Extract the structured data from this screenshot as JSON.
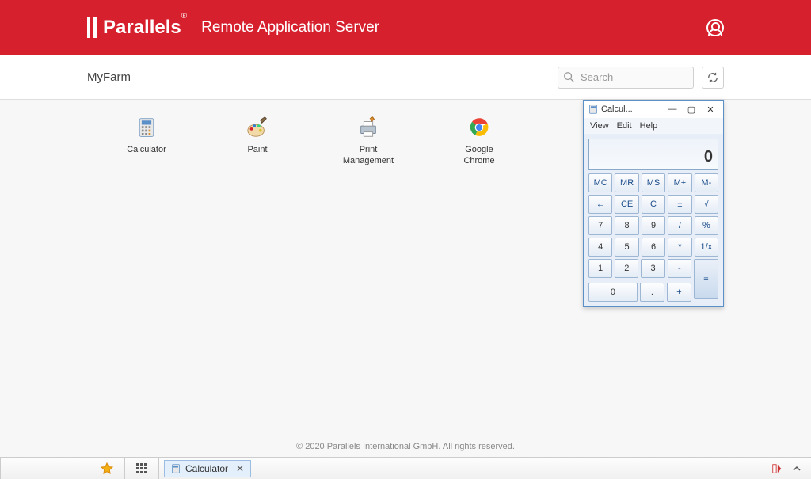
{
  "header": {
    "brand_name": "Parallels",
    "brand_reg": "®",
    "product": "Remote Application Server"
  },
  "subheader": {
    "farm": "MyFarm",
    "search_placeholder": "Search"
  },
  "apps": [
    {
      "label": "Calculator"
    },
    {
      "label": "Paint"
    },
    {
      "label": "Print Management"
    },
    {
      "label": "Google Chrome"
    }
  ],
  "calculator": {
    "title": "Calcul...",
    "menu": {
      "view": "View",
      "edit": "Edit",
      "help": "Help"
    },
    "display": "0",
    "mem": {
      "mc": "MC",
      "mr": "MR",
      "ms": "MS",
      "mplus": "M+",
      "mminus": "M-"
    },
    "ops": {
      "back": "←",
      "ce": "CE",
      "c": "C",
      "pm": "±",
      "sqrt": "√",
      "div": "/",
      "pct": "%",
      "mul": "*",
      "inv": "1/x",
      "sub": "-",
      "add": "+",
      "eq": "=",
      "dot": "."
    },
    "nums": {
      "n0": "0",
      "n1": "1",
      "n2": "2",
      "n3": "3",
      "n4": "4",
      "n5": "5",
      "n6": "6",
      "n7": "7",
      "n8": "8",
      "n9": "9"
    }
  },
  "taskbar": {
    "task_label": "Calculator"
  },
  "footer": "© 2020 Parallels International GmbH. All rights reserved."
}
